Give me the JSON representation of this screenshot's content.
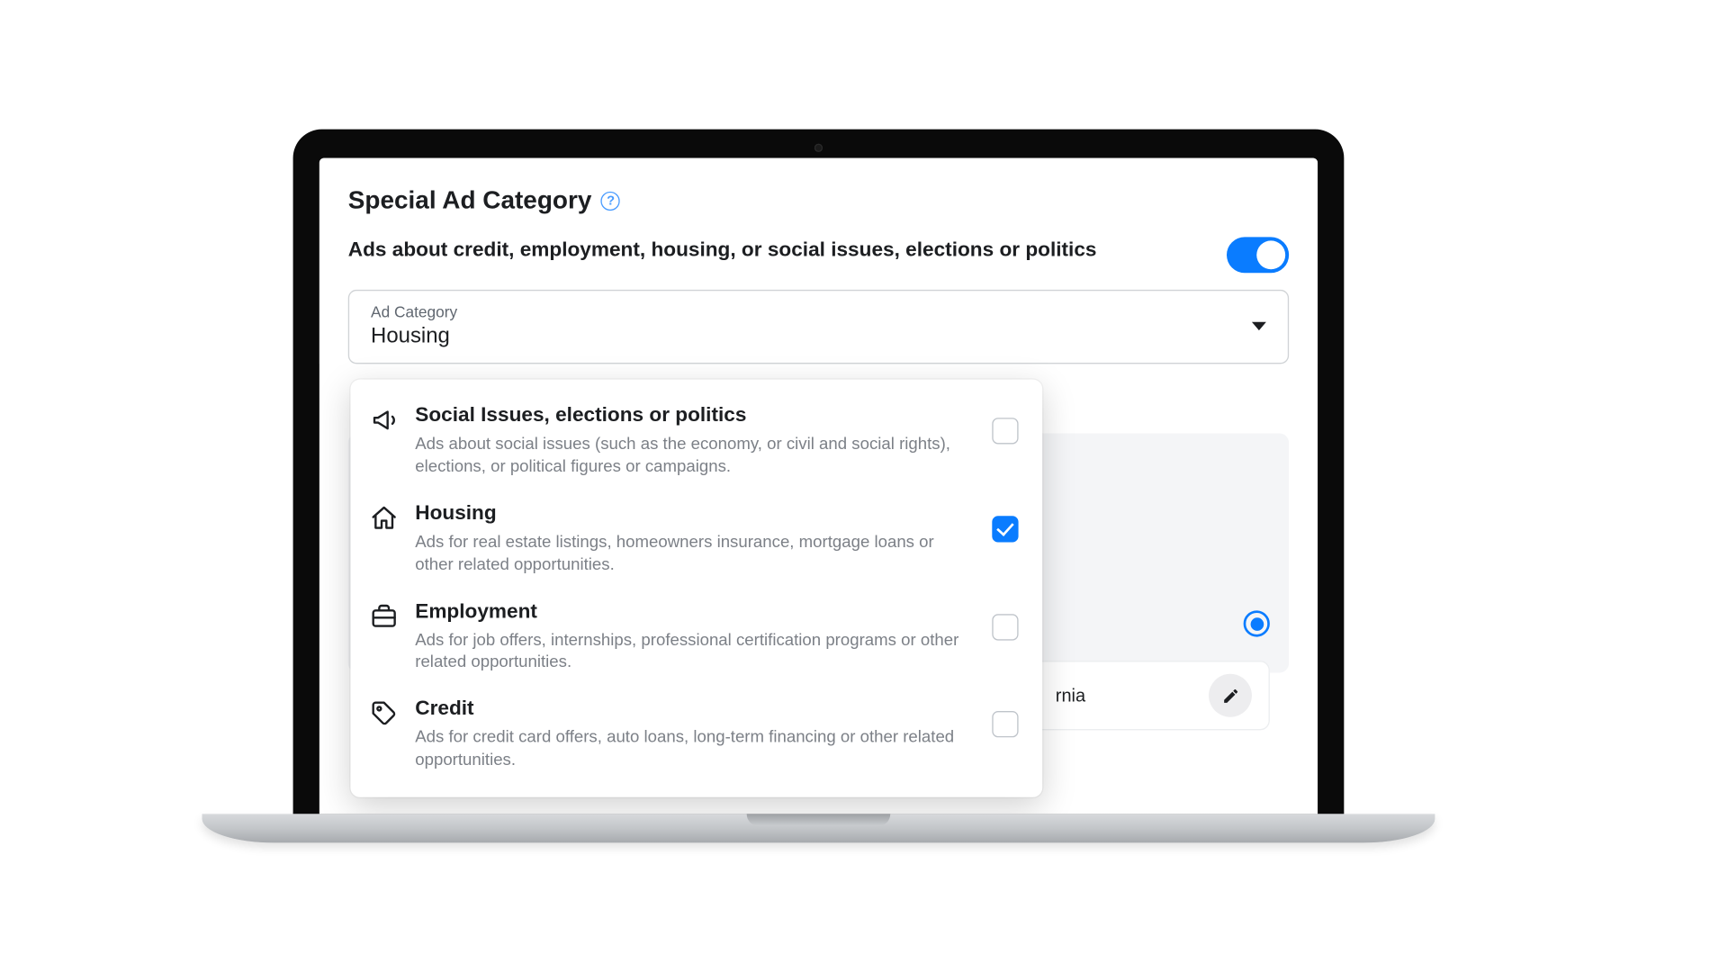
{
  "header": {
    "title": "Special Ad Category"
  },
  "sub": {
    "text": "Ads about credit, employment, housing, or social issues, elections or politics"
  },
  "toggle": {
    "on": true
  },
  "select": {
    "label": "Ad Category",
    "value": "Housing"
  },
  "options": [
    {
      "key": "social",
      "title": "Social Issues, elections or politics",
      "desc": "Ads about social issues (such as the economy, or civil and social rights), elections, or political figures or campaigns.",
      "checked": false
    },
    {
      "key": "housing",
      "title": "Housing",
      "desc": "Ads for real estate listings, homeowners insurance, mortgage loans or other related opportunities.",
      "checked": true
    },
    {
      "key": "employment",
      "title": "Employment",
      "desc": "Ads for job offers, internships, professional certification programs or other related opportunities.",
      "checked": false
    },
    {
      "key": "credit",
      "title": "Credit",
      "desc": "Ads for credit card offers, auto loans, long-term financing or other related opportunities.",
      "checked": false
    }
  ],
  "bg_text": "rnia",
  "colors": {
    "accent": "#0A7CFF"
  }
}
